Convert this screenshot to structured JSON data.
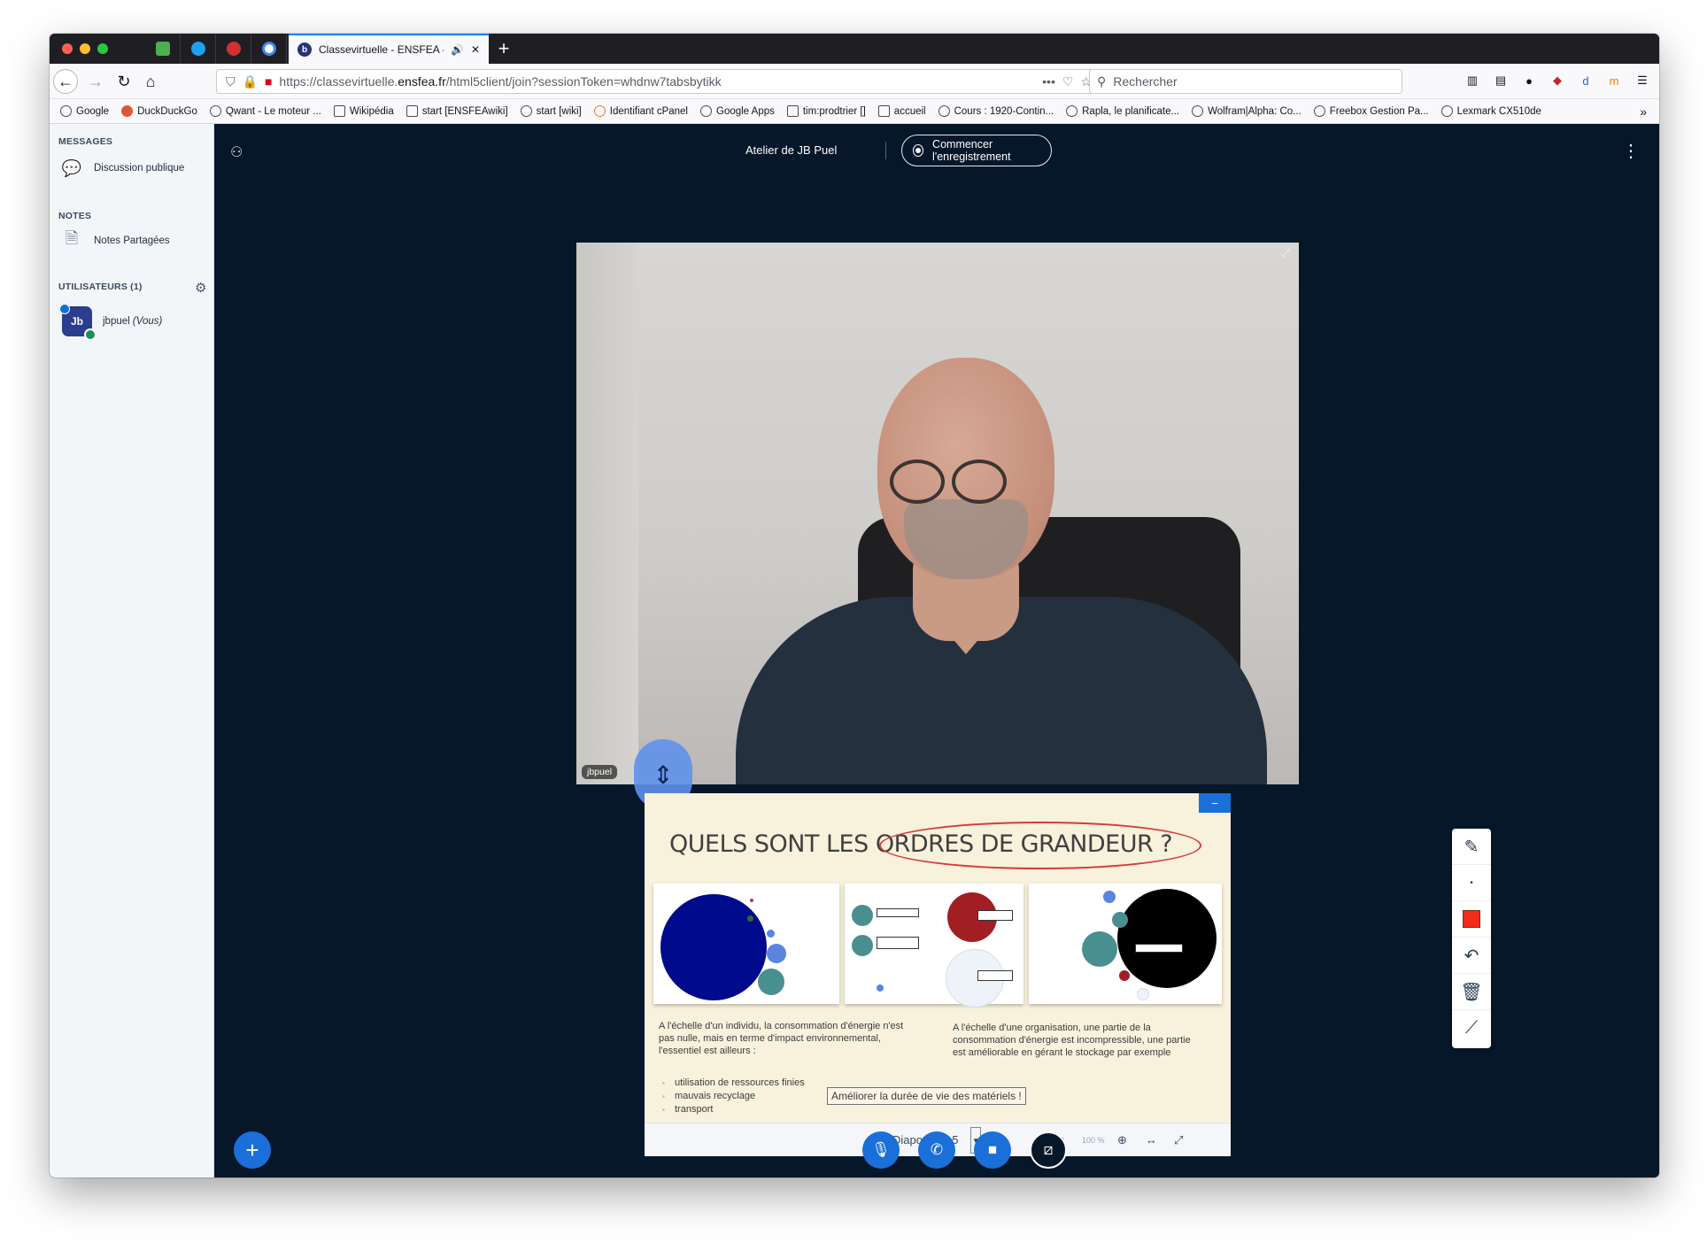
{
  "browser": {
    "active_tab_title": "Classevirtuelle - ENSFEA - A",
    "url_prefix": "https://classevirtuelle.",
    "url_domain": "ensfea.fr",
    "url_path": "/html5client/join?sessionToken=whdnw7tabsbytikk",
    "search_placeholder": "Rechercher"
  },
  "bookmarks": [
    {
      "label": "Google"
    },
    {
      "label": "DuckDuckGo"
    },
    {
      "label": "Qwant - Le moteur ..."
    },
    {
      "label": "Wikipédia"
    },
    {
      "label": "start [ENSFEAwiki]"
    },
    {
      "label": "start [wiki]"
    },
    {
      "label": "Identifiant cPanel"
    },
    {
      "label": "Google Apps"
    },
    {
      "label": "tim:prodtrier []"
    },
    {
      "label": "accueil"
    },
    {
      "label": "Cours : 1920-Contin..."
    },
    {
      "label": "Rapla, le planificate..."
    },
    {
      "label": "Wolfram|Alpha: Co..."
    },
    {
      "label": "Freebox Gestion Pa..."
    },
    {
      "label": "Lexmark CX510de"
    }
  ],
  "sidebar": {
    "messages_heading": "MESSAGES",
    "public_chat": "Discussion publique",
    "notes_heading": "NOTES",
    "shared_notes": "Notes Partagées",
    "users_heading": "UTILISATEURS (1)",
    "user_initials": "Jb",
    "user_name": "jbpuel",
    "user_you": "(Vous)"
  },
  "meeting": {
    "title": "Atelier de JB Puel",
    "record_label": "Commencer l'enregistrement",
    "video_name": "jbpuel"
  },
  "slide": {
    "title": "QUELS SONT LES ORDRES DE GRANDEUR ?",
    "left_text_1": "A l'échelle d'un individu, la consommation d'énergie n'est",
    "left_text_2": "pas nulle, mais en terme d'impact environnemental,",
    "left_text_3": "l'essentiel est ailleurs :",
    "bullets": [
      "utilisation de ressources finies",
      "mauvais recyclage",
      "transport"
    ],
    "right_text_1": "A l'échelle d'une organisation, une partie de la",
    "right_text_2": "consommation d'énergie est incompressible, une partie",
    "right_text_3": "est améliorable en gérant le stockage par exemple",
    "highlight": "Améliorer la durée de vie des matériels !"
  },
  "presentation_toolbar": {
    "slide_label": "Diapositive 5",
    "zoom": "100 %"
  },
  "colors": {
    "accent": "#1a6fd9",
    "main_bg": "#06172a",
    "sidebar_bg": "#f3f6f9",
    "annotation_color": "#f32b19"
  }
}
